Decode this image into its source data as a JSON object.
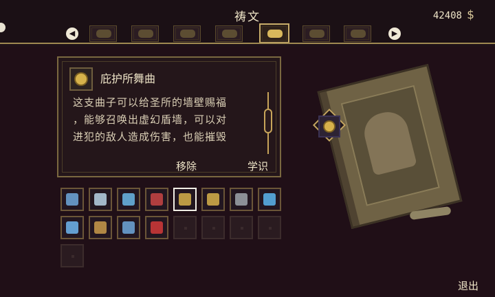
{
  "header": {
    "title": "祷文",
    "currency_amount": "42408",
    "currency_symbol": "$"
  },
  "tabs": [
    {
      "name": "tab-1",
      "icon": "rune-icon"
    },
    {
      "name": "tab-2",
      "icon": "wings-icon"
    },
    {
      "name": "tab-3",
      "icon": "scroll-icon"
    },
    {
      "name": "tab-4",
      "icon": "tower-icon"
    },
    {
      "name": "tab-5",
      "icon": "book-icon",
      "active": true
    },
    {
      "name": "tab-6",
      "icon": "arrows-icon"
    },
    {
      "name": "tab-7",
      "icon": "skull-icon"
    }
  ],
  "selected_prayer": {
    "title": "庇护所舞曲",
    "description": "这支曲子可以给圣所的墙壁赐福\n，能够召唤出虚幻盾墙，可以对\n进犯的敌人造成伤害，也能摧毁",
    "icon": "shrine-orb-icon"
  },
  "actions": {
    "remove_label": "移除",
    "learn_label": "学识"
  },
  "footer": {
    "exit_label": "退出"
  },
  "prayer_slots": [
    {
      "name": "lightning-wave-prayer",
      "color": "#6fa8dc"
    },
    {
      "name": "spiral-prayer",
      "color": "#b9d3e8"
    },
    {
      "name": "serpent-prayer",
      "color": "#6ab8e8"
    },
    {
      "name": "blade-prayer",
      "color": "#c94545"
    },
    {
      "name": "shrine-orb-prayer",
      "color": "#d7b24b",
      "selected": true
    },
    {
      "name": "altar-prayer",
      "color": "#d7b24b"
    },
    {
      "name": "crescent-prayer",
      "color": "#9fa6ad"
    },
    {
      "name": "twin-pillar-prayer",
      "color": "#5bb6f0"
    },
    {
      "name": "light-pillar-prayer",
      "color": "#6fb6f0"
    },
    {
      "name": "sigil-prayer",
      "color": "#c99b4b"
    },
    {
      "name": "storm-prayer",
      "color": "#6fa8dc"
    },
    {
      "name": "crimson-burst-prayer",
      "color": "#d23a3a"
    },
    {
      "name": "empty-slot",
      "color": ""
    },
    {
      "name": "empty-slot",
      "color": ""
    },
    {
      "name": "empty-slot",
      "color": ""
    },
    {
      "name": "empty-slot",
      "color": ""
    },
    {
      "name": "empty-slot",
      "color": ""
    }
  ]
}
